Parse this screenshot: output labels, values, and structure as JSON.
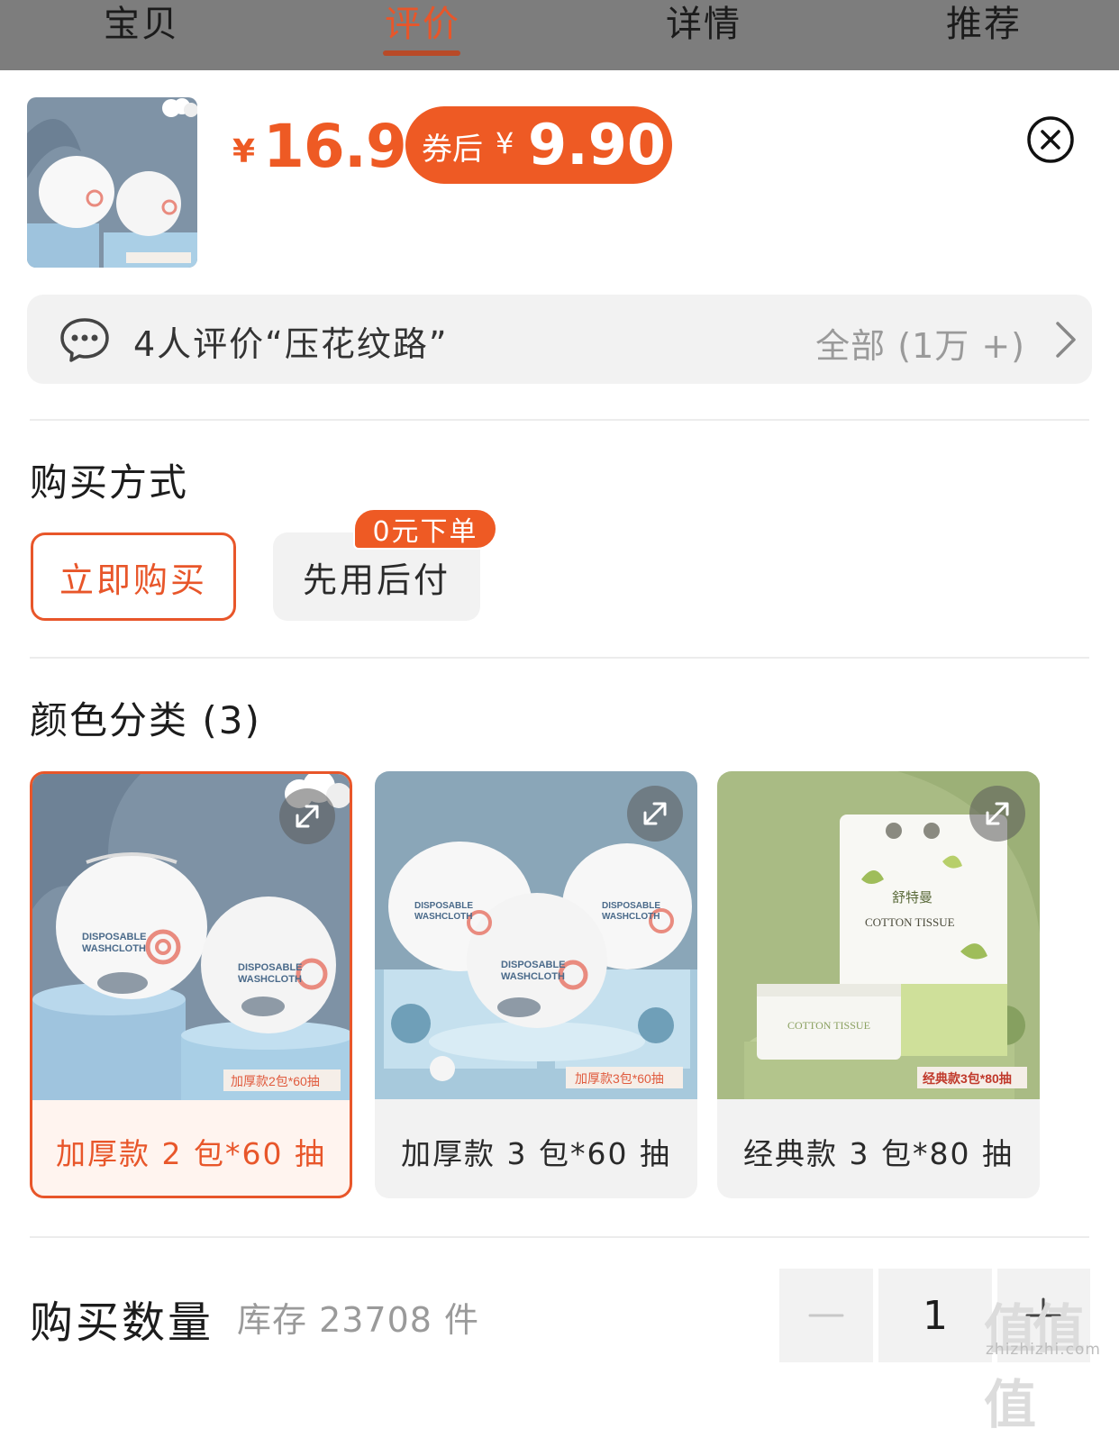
{
  "nav": {
    "tabs": [
      {
        "label": "宝贝"
      },
      {
        "label": "评价"
      },
      {
        "label": "详情"
      },
      {
        "label": "推荐"
      }
    ],
    "active_tab": "评价"
  },
  "product": {
    "currency": "¥",
    "price": "16.9",
    "coupon_label": "券后",
    "coupon_currency": "¥",
    "coupon_price": "9.90",
    "thumb_caption": "加厚款2包*60抽"
  },
  "reviews": {
    "summary": "4人评价“压花纹路”",
    "all_label": "全部 (1万 +)"
  },
  "purchase_method": {
    "title": "购买方式",
    "options": [
      {
        "label": "立即购买",
        "selected": true
      },
      {
        "label": "先用后付",
        "selected": false
      }
    ],
    "badge": "0元下单"
  },
  "color_category": {
    "title": "颜色分类 (3)",
    "items": [
      {
        "label": "加厚款 2 包*60 抽",
        "selected": true,
        "tag": "加厚款2包*60抽"
      },
      {
        "label": "加厚款 3 包*60 抽",
        "selected": false,
        "tag": "加厚款3包*60抽"
      },
      {
        "label": "经典款 3 包*80 抽",
        "selected": false,
        "tag": "经典款3包*80抽"
      }
    ]
  },
  "quantity": {
    "title": "购买数量",
    "stock": "库存 23708 件",
    "value": "1"
  },
  "watermark": {
    "logo": "值值值",
    "site": "zhizhizhi.com"
  },
  "colors": {
    "accent": "#ee5a24",
    "panel": "#f2f2f2",
    "muted": "#9a9a9a"
  }
}
